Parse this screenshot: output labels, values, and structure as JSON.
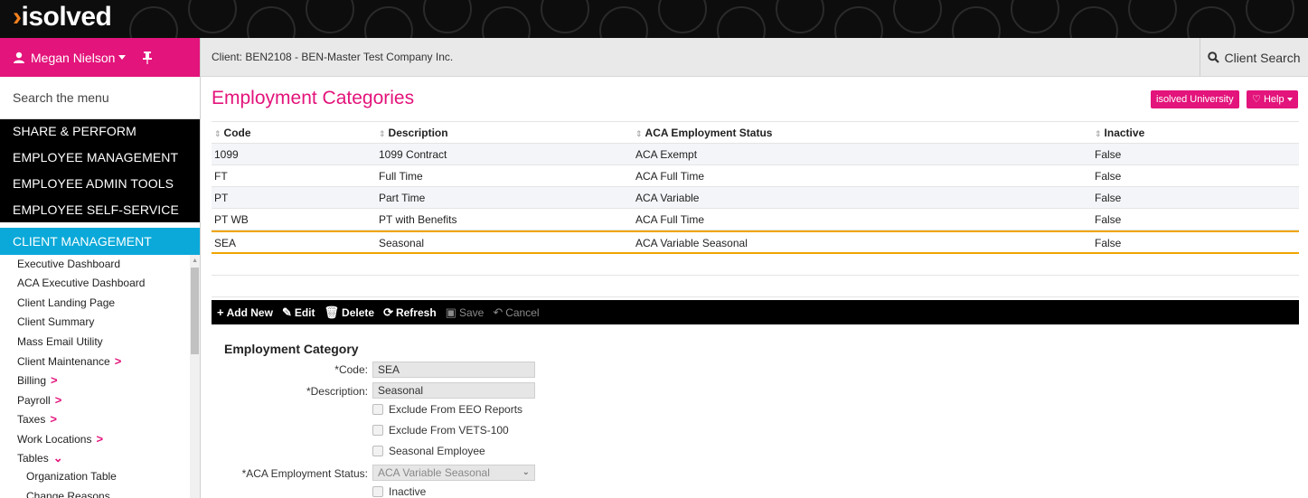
{
  "brand": {
    "logo_text": "isolved"
  },
  "user": {
    "name": "Megan Nielson"
  },
  "sidebar": {
    "search_placeholder": "Search the menu",
    "sections": [
      "SHARE & PERFORM",
      "EMPLOYEE MANAGEMENT",
      "EMPLOYEE ADMIN TOOLS",
      "EMPLOYEE SELF-SERVICE"
    ],
    "active_section": "CLIENT MANAGEMENT",
    "items": [
      {
        "label": "Executive Dashboard",
        "chevron": ""
      },
      {
        "label": "ACA Executive Dashboard",
        "chevron": ""
      },
      {
        "label": "Client Landing Page",
        "chevron": ""
      },
      {
        "label": "Client Summary",
        "chevron": ""
      },
      {
        "label": "Mass Email Utility",
        "chevron": ""
      },
      {
        "label": "Client Maintenance",
        "chevron": "right"
      },
      {
        "label": "Billing",
        "chevron": "right"
      },
      {
        "label": "Payroll",
        "chevron": "right"
      },
      {
        "label": "Taxes",
        "chevron": "right"
      },
      {
        "label": "Work Locations",
        "chevron": "right"
      },
      {
        "label": "Tables",
        "chevron": "down"
      },
      {
        "label": "Organization Table",
        "chevron": ""
      },
      {
        "label": "Change Reasons",
        "chevron": ""
      }
    ]
  },
  "client_bar": {
    "client_text": "Client: BEN2108 - BEN-Master Test Company Inc.",
    "search_label": "Client Search"
  },
  "page": {
    "title": "Employment Categories",
    "university_label": "isolved University",
    "help_label": "Help"
  },
  "grid": {
    "columns": [
      "Code",
      "Description",
      "ACA Employment Status",
      "Inactive"
    ],
    "rows": [
      [
        "1099",
        "1099 Contract",
        "ACA Exempt",
        "False"
      ],
      [
        "FT",
        "Full Time",
        "ACA Full Time",
        "False"
      ],
      [
        "PT",
        "Part Time",
        "ACA Variable",
        "False"
      ],
      [
        "PT WB",
        "PT with Benefits",
        "ACA Full Time",
        "False"
      ],
      [
        "SEA",
        "Seasonal",
        "ACA Variable Seasonal",
        "False"
      ]
    ],
    "selected_row": 4
  },
  "toolbar": {
    "add_new": "Add New",
    "edit": "Edit",
    "delete": "Delete",
    "refresh": "Refresh",
    "save": "Save",
    "cancel": "Cancel"
  },
  "form": {
    "title": "Employment Category",
    "code_label": "*Code:",
    "code_value": "SEA",
    "description_label": "*Description:",
    "description_value": "Seasonal",
    "exclude_eeo": "Exclude From EEO Reports",
    "exclude_vets": "Exclude From VETS-100",
    "seasonal_employee": "Seasonal Employee",
    "aca_status_label": "*ACA Employment Status:",
    "aca_status_value": "ACA Variable Seasonal",
    "inactive": "Inactive"
  },
  "colors": {
    "brand_pink": "#e3147b",
    "active_blue": "#0aa9d9",
    "selection_orange": "#f0a500"
  }
}
